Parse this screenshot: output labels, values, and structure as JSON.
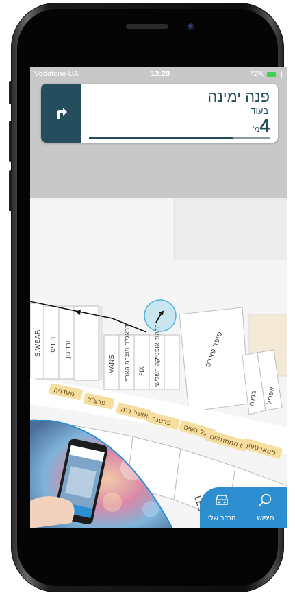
{
  "status_bar": {
    "carrier": "Vodafone UA",
    "time": "13:28",
    "battery": "72%",
    "colors": {
      "battery_fill": "#39d353"
    }
  },
  "navigation_card": {
    "instruction": "פנה ימינה",
    "in_label": "בעוד",
    "distance": "4",
    "unit": "מ'",
    "direction_icon": "turn-right-arrow-icon",
    "progress": 0.2,
    "colors": {
      "primary": "#264d5d",
      "card": "#ffffff"
    }
  },
  "map": {
    "store_labels": [
      "S.WEAR",
      "הודיס",
      "ורדינון",
      "VANS",
      "דראגלה תוצרת הארץ",
      "FIX",
      "הדהוד אופטיקה השלישי",
      "סופר פארם",
      "בגינה",
      "אפריל",
      "מעדניה",
      "פרצ'ל",
      "באושר דנה",
      "פרטנר",
      "מפעל הפיס",
      "עולם הממתקים",
      "סמארטפון",
      "LES"
    ],
    "colors": {
      "route": "#111111",
      "location_circle": "#62c1e6",
      "street_label_bg": "#f6dea1"
    }
  },
  "bottom_bar": {
    "my_car_label": "הרכב שלי",
    "search_label": "חיפוש",
    "colors": {
      "bar": "#2e8fd0"
    }
  }
}
